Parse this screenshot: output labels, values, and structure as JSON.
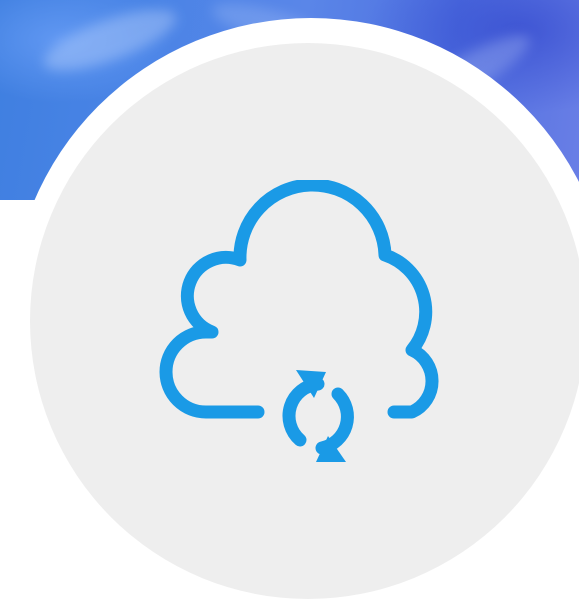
{
  "screen": {
    "banner": {
      "colors": [
        "#3f7fe0",
        "#4a84e6",
        "#5a86e8",
        "#4f6fe0",
        "#6a7fe6"
      ]
    },
    "avatar": {
      "ring_color": "#ffffff",
      "disc_color": "#eeeeee",
      "icon": {
        "name": "cloud-sync-icon",
        "color": "#1a9ae6"
      }
    }
  }
}
